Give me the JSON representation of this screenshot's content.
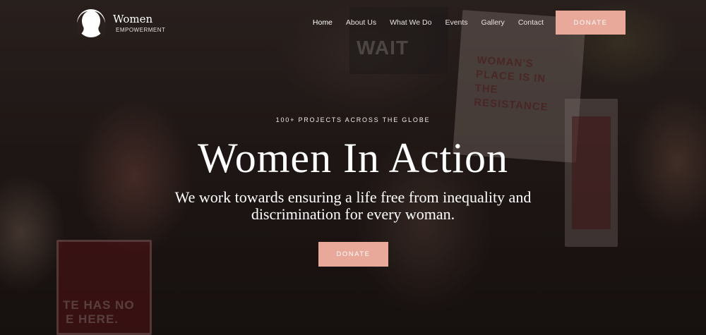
{
  "header": {
    "logo_title": "Women",
    "logo_subtitle": "EMPOWERMENT",
    "nav": [
      "Home",
      "About Us",
      "What We Do",
      "Events",
      "Gallery",
      "Contact"
    ],
    "active_nav": "Home",
    "donate_label": "DONATE"
  },
  "hero": {
    "kicker": "100+ PROJECTS ACROSS THE GLOBE",
    "title": "Women In Action",
    "subtitle_line1": "We work towards ensuring a life free from inequality and",
    "subtitle_line2": "discrimination for every woman.",
    "donate_label": "DONATE"
  },
  "background_signs": {
    "sign_left": "TE HAS NO",
    "sign_left_2": "E HERE.",
    "sign_top": "WAIT",
    "sign_right": "WOMAN'S PLACE IS IN THE RESISTANCE"
  },
  "colors": {
    "accent": "#e8a99a",
    "text": "#ffffff"
  }
}
